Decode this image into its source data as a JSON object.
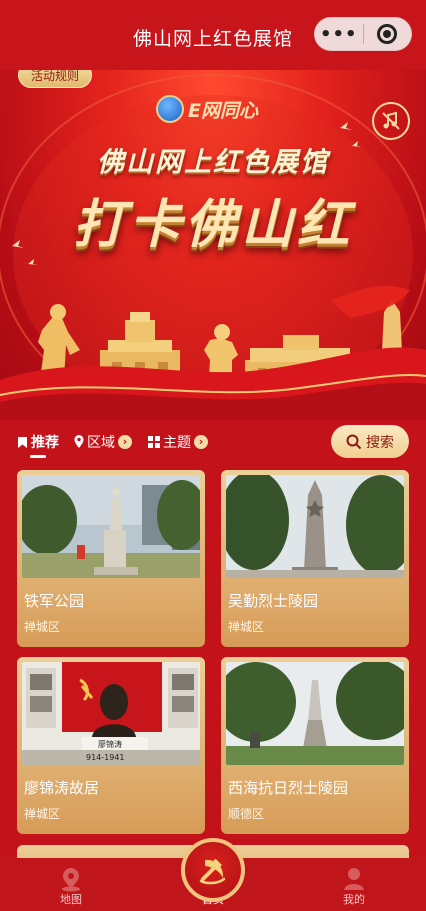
{
  "nav": {
    "title": "佛山网上红色展馆",
    "more_glyph": "•••"
  },
  "banner": {
    "activity_rules": "活动规则",
    "logo_text": "E网同心",
    "subtitle": "佛山网上红色展馆",
    "main_title": "打卡佛山红"
  },
  "tabs": [
    {
      "label": "推荐",
      "icon": "bookmark-icon",
      "active": true
    },
    {
      "label": "区域",
      "icon": "location-pin-icon",
      "active": false
    },
    {
      "label": "主题",
      "icon": "grid-icon",
      "active": false
    }
  ],
  "search": {
    "label": "搜索",
    "icon": "search-icon"
  },
  "cards": [
    {
      "name": "铁军公园",
      "district": "禅城区"
    },
    {
      "name": "吴勤烈士陵园",
      "district": "禅城区"
    },
    {
      "name": "廖锦涛故居",
      "district": "禅城区",
      "photo_caption": "廖锦涛",
      "photo_years": "914-1941"
    },
    {
      "name": "西海抗日烈士陵园",
      "district": "顺德区"
    }
  ],
  "tabbar": [
    {
      "label": "地图",
      "icon": "map-pin-icon",
      "active": false
    },
    {
      "label": "首页",
      "icon": "hammer-sickle-icon",
      "active": true
    },
    {
      "label": "我的",
      "icon": "user-icon",
      "active": false
    }
  ],
  "colors": {
    "primary_red": "#c8141b",
    "gold": "#f1cf90",
    "card_gold": "#d79b58"
  }
}
